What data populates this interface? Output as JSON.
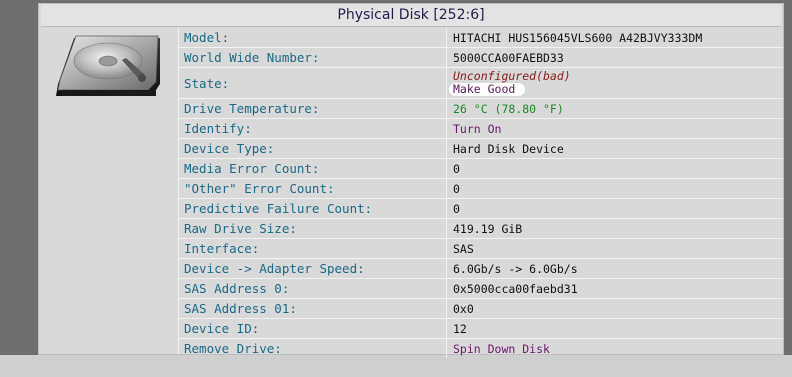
{
  "title": "Physical Disk [252:6]",
  "icon": "hard-disk-drive-icon",
  "colors": {
    "label": "#1d6b86",
    "value": "#111111",
    "bad_state": "#8a1b1b",
    "temperature": "#1e8a2a",
    "action_link": "#6b1a6b"
  },
  "rows": [
    {
      "label": "Model:",
      "value": "HITACHI HUS156045VLS600 A42BJVY333DM"
    },
    {
      "label": "World Wide Number:",
      "value": "5000CCA00FAEBD33"
    },
    {
      "label": "State:",
      "value": "Unconfigured(bad)",
      "action": "Make Good"
    },
    {
      "label": "Drive Temperature:",
      "value": "26 °C (78.80 °F)"
    },
    {
      "label": "Identify:",
      "value": "Turn On"
    },
    {
      "label": "Device Type:",
      "value": "Hard Disk Device"
    },
    {
      "label": "Media Error Count:",
      "value": "0"
    },
    {
      "label": "\"Other\" Error Count:",
      "value": "0"
    },
    {
      "label": "Predictive Failure Count:",
      "value": "0"
    },
    {
      "label": "Raw Drive Size:",
      "value": "419.19 GiB"
    },
    {
      "label": "Interface:",
      "value": "SAS"
    },
    {
      "label": "Device -> Adapter Speed:",
      "value": "6.0Gb/s -> 6.0Gb/s"
    },
    {
      "label": "SAS Address 0:",
      "value": "0x5000cca00faebd31"
    },
    {
      "label": "SAS Address 01:",
      "value": "0x0"
    },
    {
      "label": "Device ID:",
      "value": "12"
    },
    {
      "label": "Remove Drive:",
      "value": "Spin Down Disk"
    }
  ]
}
